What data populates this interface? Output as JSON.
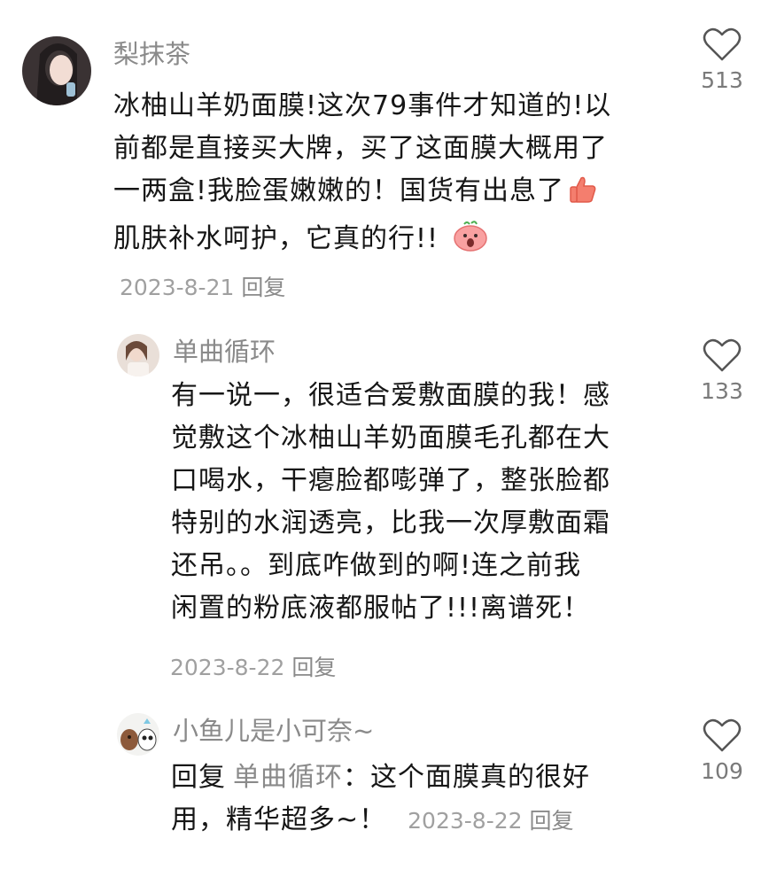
{
  "comments": [
    {
      "username": "梨抹茶",
      "lines": [
        "冰柚山羊奶面膜!这次79事件才知道的!以",
        "前都是直接买大牌，买了这面膜大概用了",
        "一两盒!我脸蛋嫩嫩的！国货有出息了",
        "肌肤补水呵护，它真的行!! "
      ],
      "date": "2023-8-21",
      "reply_label": "回复",
      "likes": "513"
    },
    {
      "username": "单曲循环",
      "lines": [
        "有一说一，很适合爱敷面膜的我！感",
        "觉敷这个冰柚山羊奶面膜毛孔都在大",
        "口喝水，干瘪脸都嘭弹了，整张脸都",
        "特别的水润透亮，比我一次厚敷面霜",
        "还吊。。到底咋做到的啊!连之前我",
        "闲置的粉底液都服帖了!!!离谱死！"
      ],
      "date": "2023-8-22",
      "reply_label": "回复",
      "likes": "133"
    },
    {
      "username": "小鱼儿是小可奈~",
      "reply_prefix": "回复",
      "reply_to": "单曲循环",
      "reply_sep": "：",
      "line1_text": "这个面膜真的很好",
      "line2_text": "用，精华超多~！",
      "date": "2023-8-22",
      "reply_label": "回复",
      "likes": "109"
    }
  ],
  "icons": {
    "like": "heart-outline-icon",
    "thumbs_up_emoji": "thumbs-up-emoji",
    "shocked_face_emoji": "shocked-face-emoji"
  },
  "colors": {
    "username": "#8a8a8a",
    "body": "#161616",
    "meta": "#a0a0a0"
  }
}
